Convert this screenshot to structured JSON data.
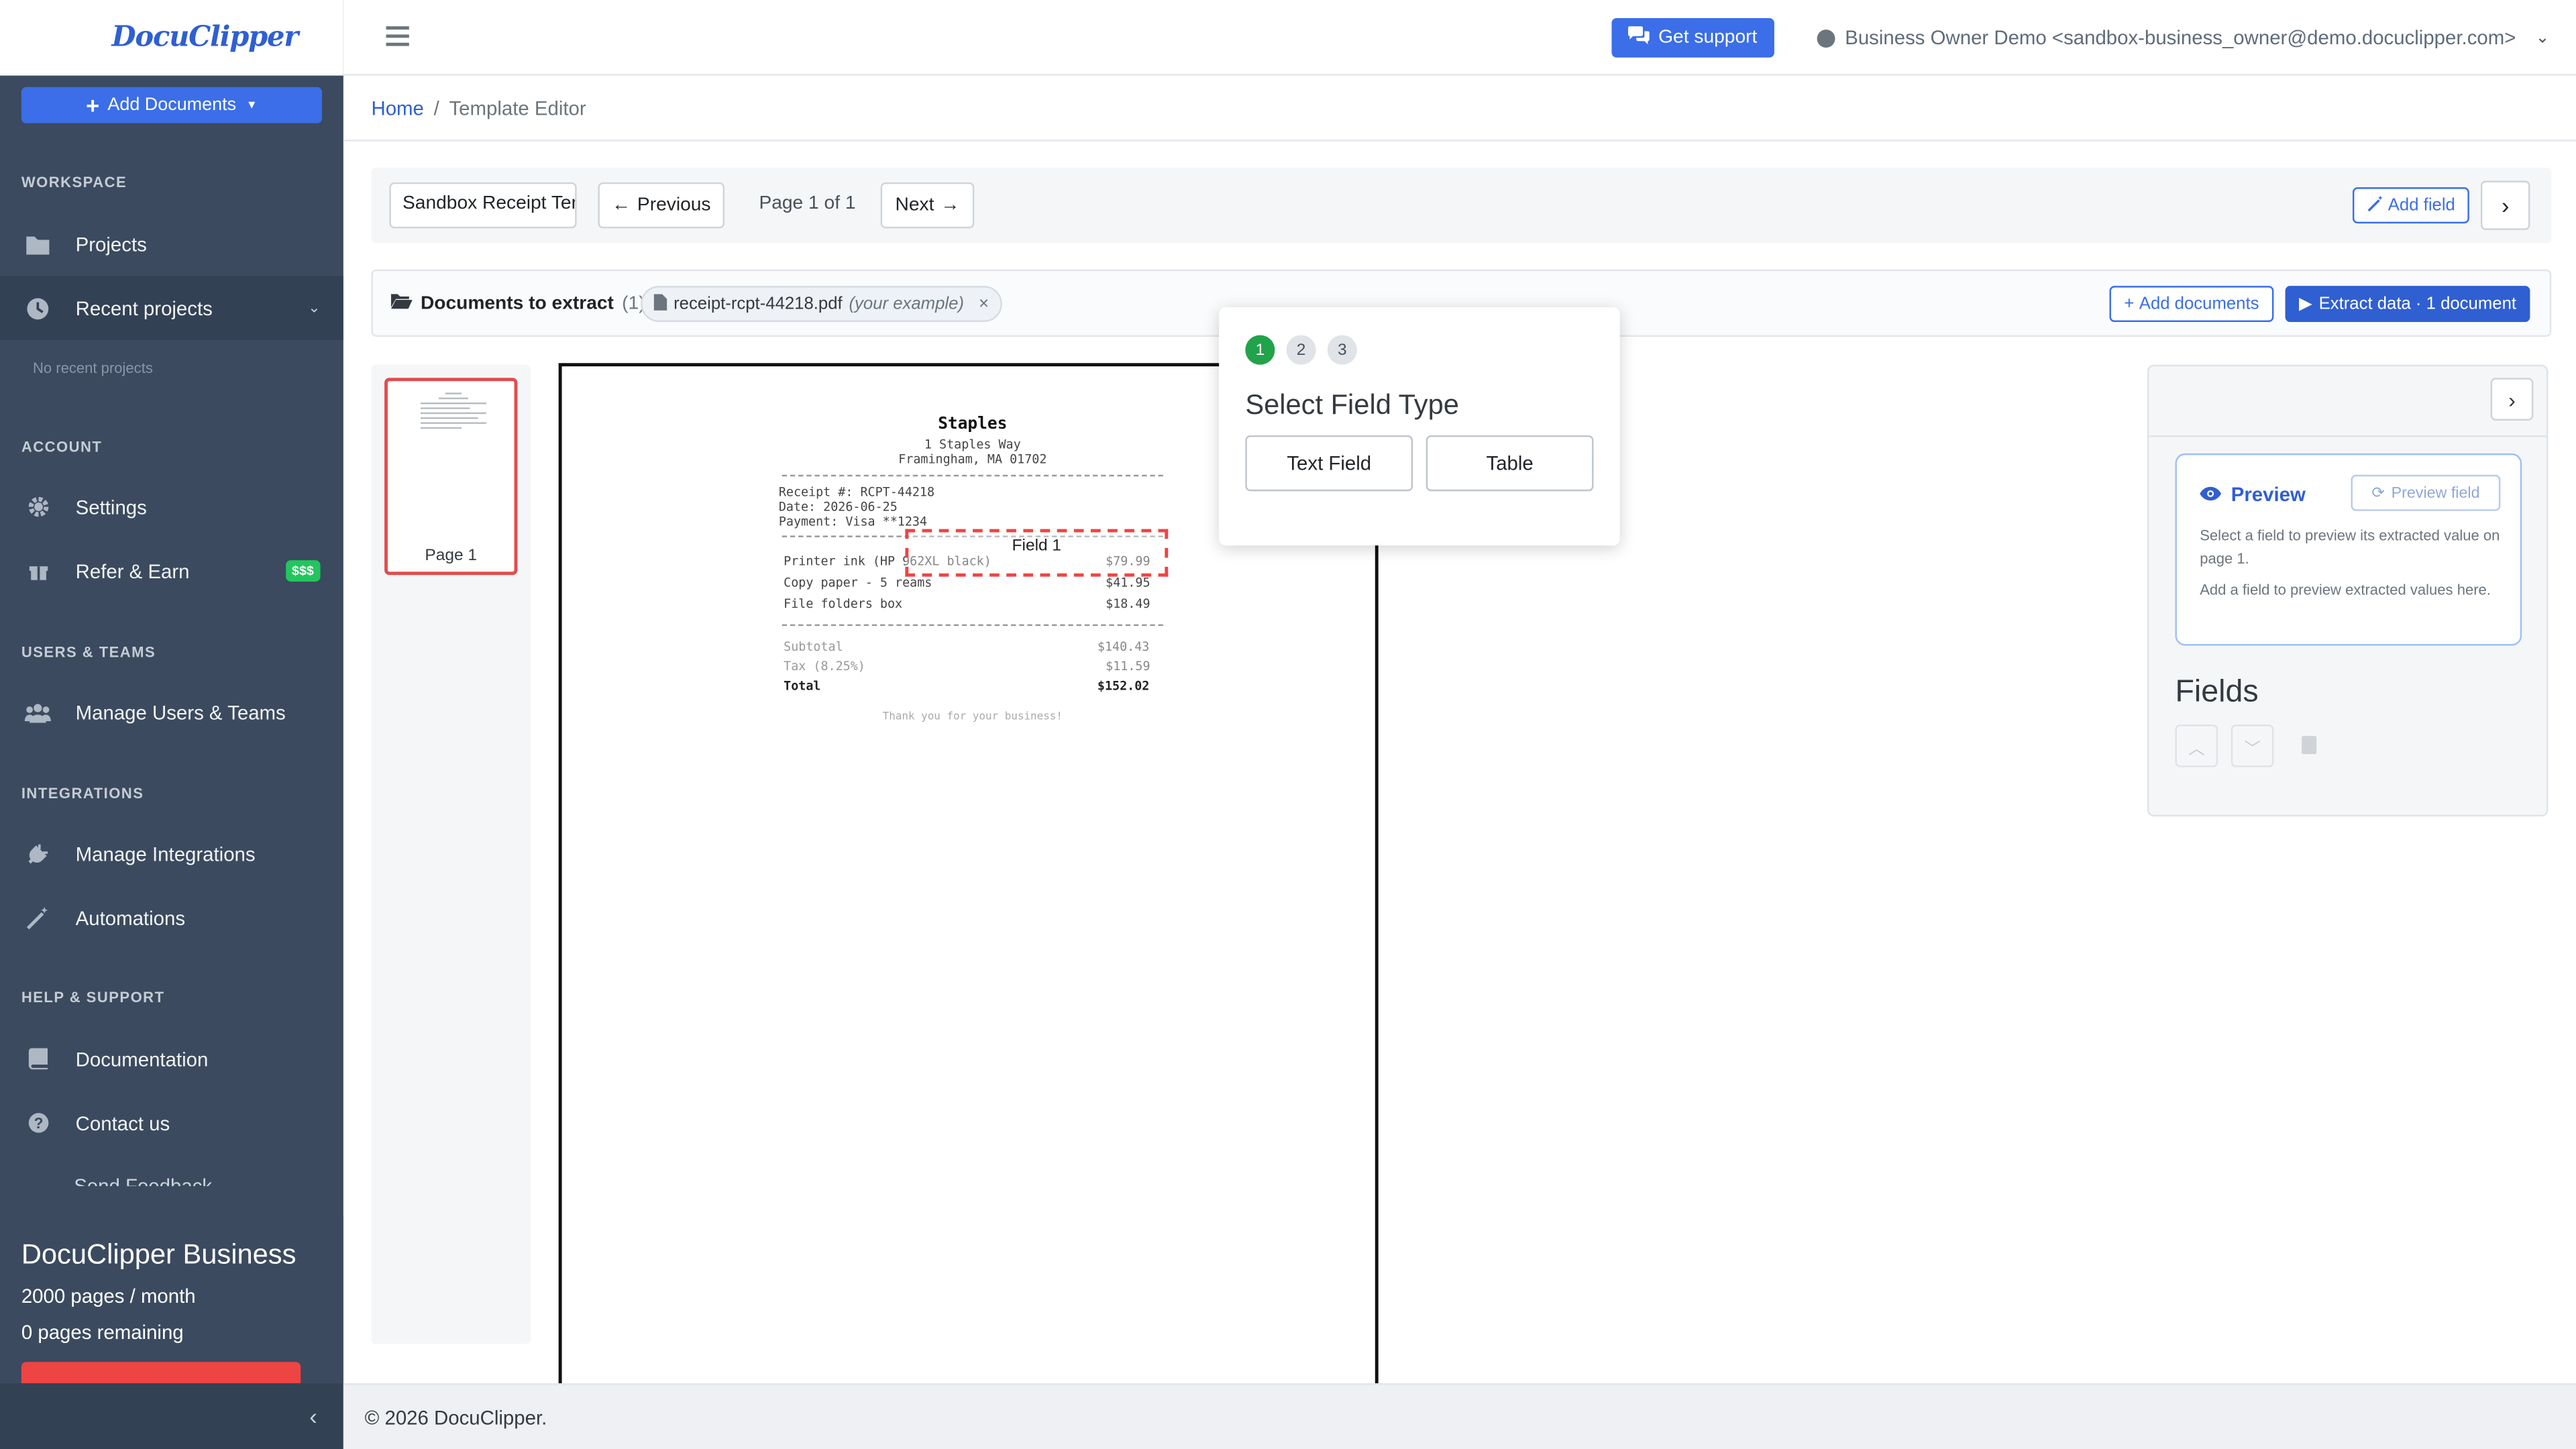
{
  "app": {
    "logo_text": "DocuClipper"
  },
  "sidebar": {
    "add_documents_label": "Add Documents",
    "sections": {
      "workspace": "WORKSPACE",
      "account": "ACCOUNT",
      "users_teams": "USERS & TEAMS",
      "integrations": "INTEGRATIONS",
      "help_support": "HELP & SUPPORT"
    },
    "items": {
      "projects": "Projects",
      "recent_projects": "Recent projects",
      "no_recent": "No recent projects",
      "settings": "Settings",
      "refer_earn": "Refer & Earn",
      "refer_badge": "$$$",
      "manage_users": "Manage Users & Teams",
      "manage_integrations": "Manage Integrations",
      "automations": "Automations",
      "documentation": "Documentation",
      "contact_us": "Contact us",
      "send_feedback": "Send Feedback"
    },
    "plan": {
      "name": "DocuClipper Business",
      "pages_per_month": "2000 pages / month",
      "pages_remaining": "0 pages remaining"
    }
  },
  "topbar": {
    "support_label": "Get support",
    "user_label": "Business Owner Demo <sandbox-business_owner@demo.docuclipper.com>"
  },
  "breadcrumb": {
    "home": "Home",
    "separator": "/",
    "current": "Template Editor"
  },
  "toolbar": {
    "template_name": "Sandbox Receipt Template",
    "previous_label": "Previous",
    "page_indicator": "Page 1 of 1",
    "next_label": "Next",
    "add_field_label": "Add field"
  },
  "docs_bar": {
    "title": "Documents to extract",
    "count": "(1)",
    "file_name": "receipt-rcpt-44218.pdf",
    "file_note": "(your example)",
    "add_documents_label": "Add documents",
    "extract_label": "Extract data · 1 document"
  },
  "thumbnails": [
    {
      "label": "Page 1"
    }
  ],
  "receipt": {
    "store": "Staples",
    "address1": "1 Staples Way",
    "address2": "Framingham, MA 01702",
    "receipt_no": "Receipt #: RCPT-44218",
    "date": "Date: 2026-06-25",
    "payment": "Payment: Visa **1234",
    "items": [
      {
        "desc": "Printer ink (HP 962XL black)",
        "amount": "$79.99"
      },
      {
        "desc": "Copy paper - 5 reams",
        "amount": "$41.95"
      },
      {
        "desc": "File folders box",
        "amount": "$18.49"
      }
    ],
    "subtotal_label": "Subtotal",
    "subtotal": "$140.43",
    "tax_label": "Tax (8.25%)",
    "tax": "$11.59",
    "total_label": "Total",
    "total": "$152.02",
    "thanks": "Thank you for your business!",
    "field_label": "Field 1"
  },
  "popover": {
    "steps": [
      "1",
      "2",
      "3"
    ],
    "active_step": 1,
    "title": "Select Field Type",
    "option_text": "Text Field",
    "option_table": "Table"
  },
  "right_panel": {
    "preview_title": "Preview",
    "preview_field_label": "Preview field",
    "preview_text1": "Select a field to preview its extracted value on page 1.",
    "preview_text2": "Add a field to preview extracted values here.",
    "fields_title": "Fields"
  },
  "footer": {
    "copyright": "© 2026 DocuClipper."
  },
  "colors": {
    "primary": "#3b6ee8",
    "sidebar": "#3b4a5e",
    "success": "#22a34a",
    "danger": "#ef4444"
  }
}
